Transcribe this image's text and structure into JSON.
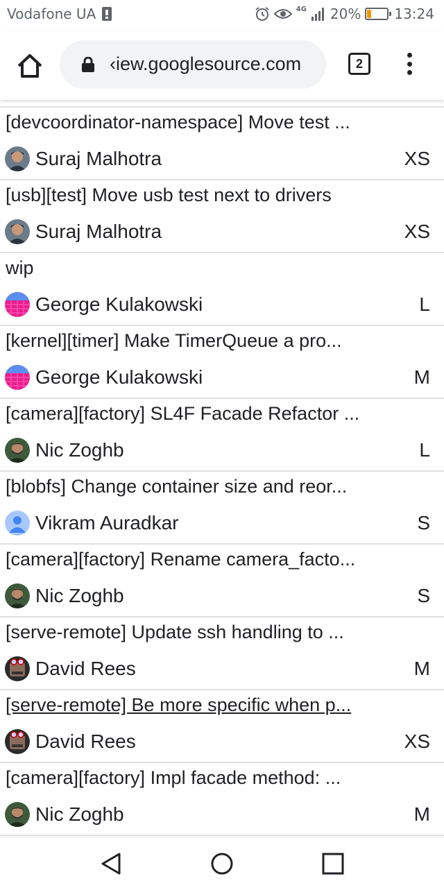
{
  "status_bar": {
    "carrier": "Vodafone UA",
    "network": "4G",
    "battery_percent": "20%",
    "battery_level": 0.2,
    "time": "13:24"
  },
  "browser": {
    "url": "‹iew.googlesource.com",
    "tab_count": "2",
    "icons": [
      "home-icon",
      "lock-icon",
      "tab-switcher-icon",
      "more-vert-icon"
    ]
  },
  "changes": [
    {
      "title": "[devcoordinator-namespace] Move test ...",
      "owner": "Suraj Malhotra",
      "size": "XS",
      "avatar": "photo-dark"
    },
    {
      "title": "[usb][test] Move usb test next to drivers",
      "owner": "Suraj Malhotra",
      "size": "XS",
      "avatar": "photo-dark"
    },
    {
      "title": "wip",
      "owner": "George Kulakowski",
      "size": "L",
      "avatar": "pink-grid"
    },
    {
      "title": "[kernel][timer] Make TimerQueue a pro...",
      "owner": "George Kulakowski",
      "size": "M",
      "avatar": "pink-grid"
    },
    {
      "title": "[camera][factory] SL4F Facade Refactor ...",
      "owner": "Nic Zoghb",
      "size": "L",
      "avatar": "photo-green"
    },
    {
      "title": "[blobfs] Change container size and reor...",
      "owner": "Vikram Auradkar",
      "size": "S",
      "avatar": "default-person"
    },
    {
      "title": "[camera][factory] Rename camera_facto...",
      "owner": "Nic Zoghb",
      "size": "S",
      "avatar": "photo-green"
    },
    {
      "title": "[serve-remote] Update ssh handling to ...",
      "owner": "David Rees",
      "size": "M",
      "avatar": "robot"
    },
    {
      "title": "[serve-remote] Be more specific when p...",
      "owner": "David Rees",
      "size": "XS",
      "avatar": "robot",
      "underlined": true
    },
    {
      "title": "[camera][factory] Impl facade method: ...",
      "owner": "Nic Zoghb",
      "size": "M",
      "avatar": "photo-green"
    }
  ],
  "nav_bar": {
    "icons": [
      "back-triangle-icon",
      "home-circle-icon",
      "recents-square-icon"
    ]
  }
}
